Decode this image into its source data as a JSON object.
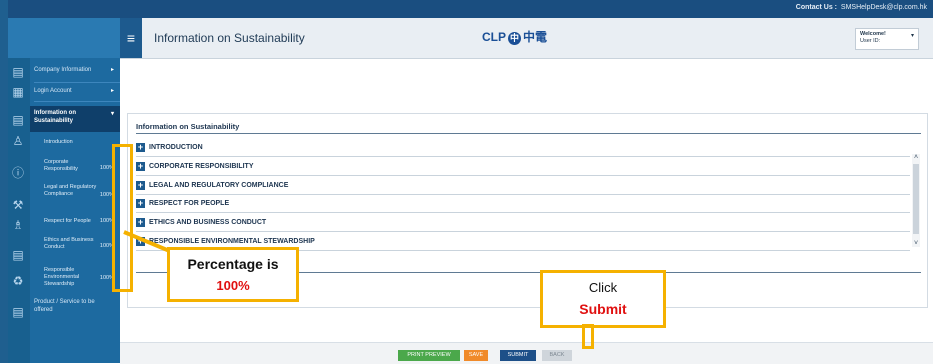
{
  "topbar": {
    "contact_label": "Contact Us :",
    "email": "SMSHelpDesk@clp.com.hk"
  },
  "header": {
    "page_title": "Information on Sustainability",
    "brand_en": "CLP",
    "brand_zh": "中電",
    "welcome": "Welcome!",
    "user_id": "User ID:"
  },
  "sidebar": {
    "items": [
      {
        "label": "Company Information",
        "icon": "document-icon"
      },
      {
        "label": "Login Account",
        "icon": "grid-icon"
      },
      {
        "label": "Information on Sustainability",
        "icon": "document-icon"
      }
    ],
    "sub_items": [
      {
        "label": "Introduction",
        "pct": ""
      },
      {
        "label": "Corporate Responsibility",
        "pct": "100%"
      },
      {
        "label": "Legal and Regulatory Compliance",
        "pct": "100%"
      },
      {
        "label": "Respect for People",
        "pct": "100%"
      },
      {
        "label": "Ethics and Business Conduct",
        "pct": "100%"
      },
      {
        "label": "Responsible Environmental Stewardship",
        "pct": "100%"
      }
    ],
    "bottom_item": "Product / Service to be offered"
  },
  "panel": {
    "title": "Information on Sustainability",
    "sections": [
      "INTRODUCTION",
      "CORPORATE RESPONSIBILITY",
      "LEGAL AND REGULATORY COMPLIANCE",
      "RESPECT FOR PEOPLE",
      "ETHICS AND BUSINESS CONDUCT",
      "RESPONSIBLE ENVIRONMENTAL STEWARDSHIP"
    ]
  },
  "buttons": {
    "print_preview": "PRINT PREVIEW",
    "save": "SAVE",
    "submit": "SUBMIT",
    "back": "BACK"
  },
  "annotations": {
    "pct_line1": "Percentage is",
    "pct_line2": "100%",
    "submit_line1": "Click",
    "submit_line2": "Submit"
  },
  "colors": {
    "brand": "#1a4f96",
    "highlight": "#f5b100",
    "emphasis": "#e01010",
    "submit": "#1d4f88"
  }
}
